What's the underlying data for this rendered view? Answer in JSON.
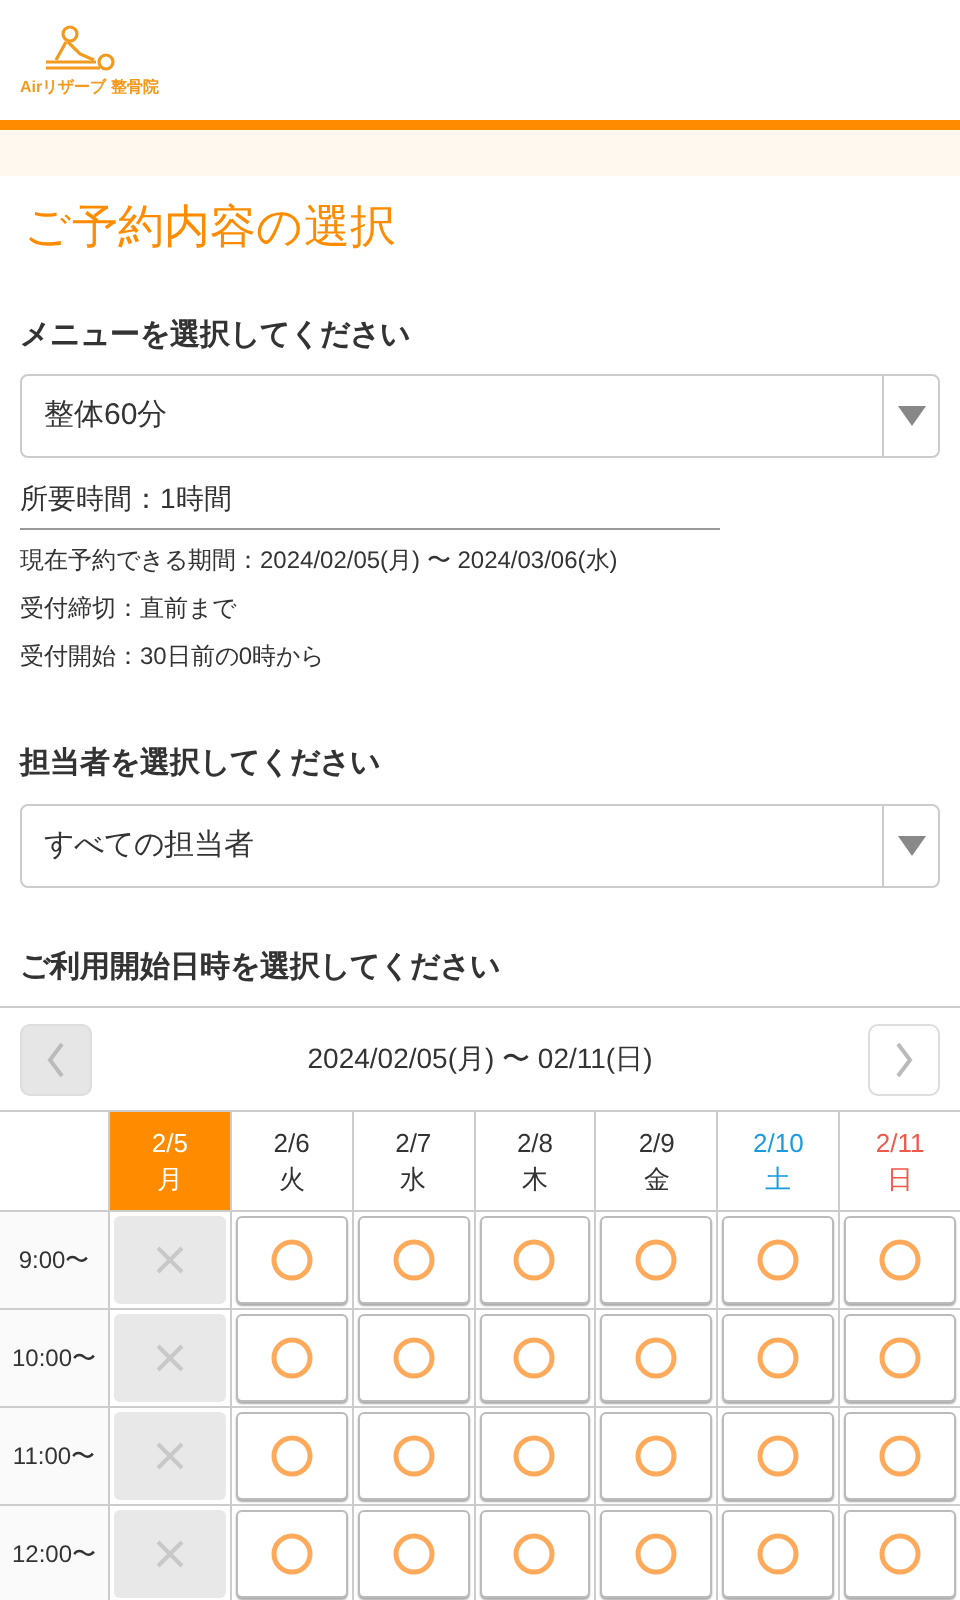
{
  "logo": {
    "text": "Airリザーブ 整骨院"
  },
  "page_title": "ご予約内容の選択",
  "menu": {
    "label": "メニューを選択してください",
    "value": "整体60分",
    "duration": "所要時間：1時間",
    "info": [
      "現在予約できる期間：2024/02/05(月) 〜 2024/03/06(水)",
      "受付締切：直前まで",
      "受付開始：30日前の0時から"
    ]
  },
  "staff": {
    "label": "担当者を選択してください",
    "value": "すべての担当者"
  },
  "calendar": {
    "label": "ご利用開始日時を選択してください",
    "range": "2024/02/05(月) 〜 02/11(日)",
    "prev_disabled": true,
    "next_disabled": false,
    "days": [
      {
        "date": "2/5",
        "weekday": "月",
        "kind": "weekday",
        "selected": true
      },
      {
        "date": "2/6",
        "weekday": "火",
        "kind": "weekday",
        "selected": false
      },
      {
        "date": "2/7",
        "weekday": "水",
        "kind": "weekday",
        "selected": false
      },
      {
        "date": "2/8",
        "weekday": "木",
        "kind": "weekday",
        "selected": false
      },
      {
        "date": "2/9",
        "weekday": "金",
        "kind": "weekday",
        "selected": false
      },
      {
        "date": "2/10",
        "weekday": "土",
        "kind": "saturday",
        "selected": false
      },
      {
        "date": "2/11",
        "weekday": "日",
        "kind": "sunday",
        "selected": false
      }
    ],
    "slots": [
      {
        "time": "9:00〜",
        "available": [
          false,
          true,
          true,
          true,
          true,
          true,
          true
        ]
      },
      {
        "time": "10:00〜",
        "available": [
          false,
          true,
          true,
          true,
          true,
          true,
          true
        ]
      },
      {
        "time": "11:00〜",
        "available": [
          false,
          true,
          true,
          true,
          true,
          true,
          true
        ]
      },
      {
        "time": "12:00〜",
        "available": [
          false,
          true,
          true,
          true,
          true,
          true,
          true
        ]
      }
    ]
  }
}
